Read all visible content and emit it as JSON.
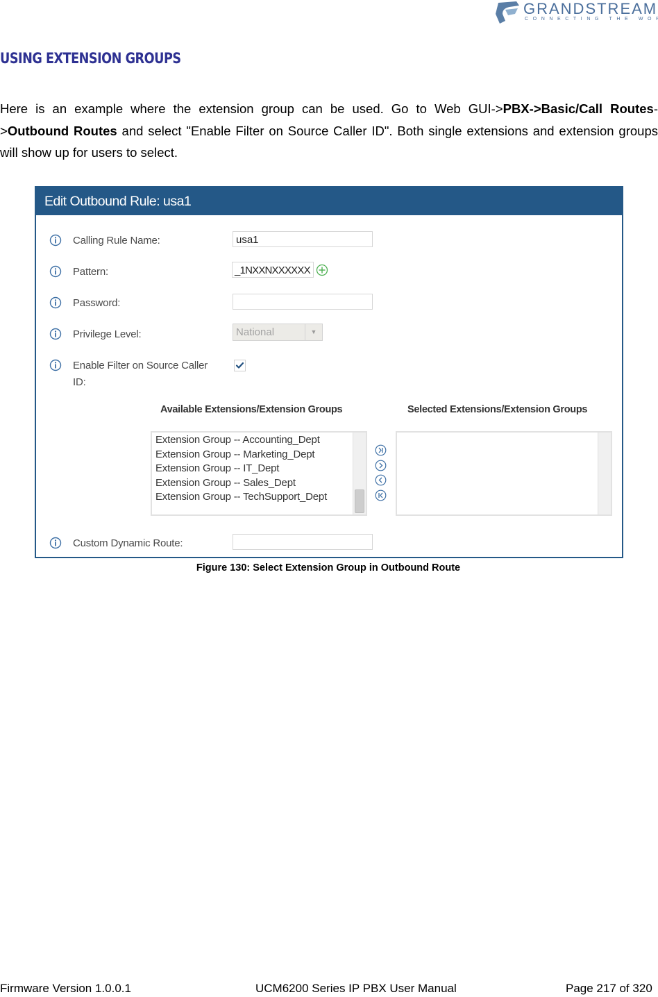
{
  "header": {
    "logo": {
      "wordmark": "GRANDSTREAM",
      "tagline": "CONNECTING THE WORLD",
      "colors": {
        "primary": "#4b6f9c"
      }
    }
  },
  "section": {
    "title": "USING EXTENSION GROUPS",
    "title_color": "#2e3192"
  },
  "intro": {
    "part1": "Here is an example where the extension group can be used. Go to Web GUI->",
    "bold1": "PBX",
    "arrow1": "->",
    "bold2": "Basic/Call Routes",
    "arrow2": "->",
    "bold3": "Outbound Routes",
    "part2": " and select \"Enable Filter on Source Caller ID\". Both single extensions and extension groups will show up for users to select."
  },
  "figure": {
    "header_color": "#245887",
    "title": "Edit Outbound Rule: usa1",
    "fields": {
      "calling_rule_name": {
        "label": "Calling Rule Name:",
        "value": "usa1"
      },
      "pattern": {
        "label": "Pattern:",
        "value": "_1NXXNXXXXXX"
      },
      "password": {
        "label": "Password:",
        "value": ""
      },
      "privilege_level": {
        "label": "Privilege Level:",
        "value": "National"
      },
      "enable_filter": {
        "label_line1": "Enable Filter on Source Caller",
        "label_line2": "ID:",
        "checked": true
      },
      "custom_dynamic_route": {
        "label": "Custom Dynamic Route:",
        "value": ""
      }
    },
    "available": {
      "title": "Available Extensions/Extension Groups",
      "items": [
        "Extension Group -- Accounting_Dept",
        "Extension Group -- Marketing_Dept",
        "Extension Group -- IT_Dept",
        "Extension Group -- Sales_Dept",
        "Extension Group -- TechSupport_Dept"
      ]
    },
    "selected": {
      "title": "Selected Extensions/Extension Groups",
      "items": []
    },
    "move_buttons": [
      "move-all-right",
      "move-right",
      "move-left",
      "move-all-left"
    ],
    "caption": "Figure 130: Select Extension Group in Outbound Route"
  },
  "footer": {
    "firmware": "Firmware Version 1.0.0.1",
    "manual": "UCM6200 Series IP PBX User Manual",
    "page": "Page 217 of 320"
  }
}
